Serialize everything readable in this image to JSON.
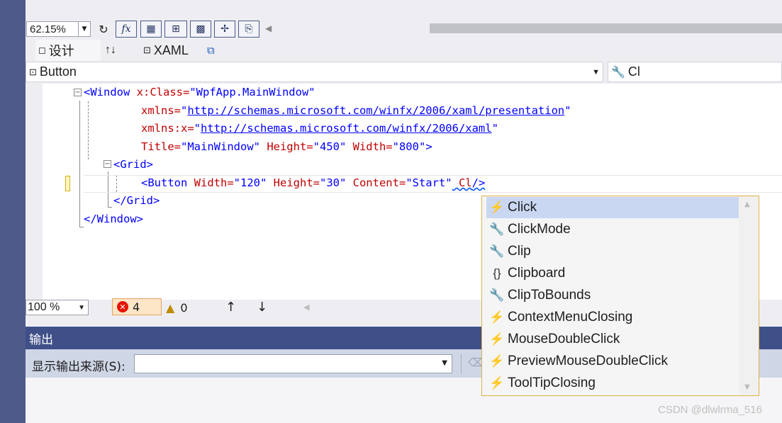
{
  "toolbar": {
    "zoom_value": "62.15%",
    "fx_label": "fx"
  },
  "tabs": {
    "design": "设计",
    "swap": "↑↓",
    "xaml": "XAML"
  },
  "combos": {
    "element": "Button",
    "member": "Cl"
  },
  "code": {
    "l1_tag": "<Window",
    "l1_attr": " x:Class=",
    "l1_val": "\"WpfApp.MainWindow\"",
    "l2_attr": "xmlns=",
    "l2_q1": "\"",
    "l2_url": "http://schemas.microsoft.com/winfx/2006/xaml/presentation",
    "l2_q2": "\"",
    "l3_attr": "xmlns:x=",
    "l3_q1": "\"",
    "l3_url": "http://schemas.microsoft.com/winfx/2006/xaml",
    "l3_q2": "\"",
    "l4_attr1": "Title=",
    "l4_val1": "\"MainWindow\"",
    "l4_attr2": " Height=",
    "l4_val2": "\"450\"",
    "l4_attr3": " Width=",
    "l4_val3": "\"800\"",
    "l4_end": ">",
    "l5": "<Grid>",
    "l6_tag": "<Button",
    "l6_attr1": " Width=",
    "l6_val1": "\"120\"",
    "l6_attr2": " Height=",
    "l6_val2": "\"30\"",
    "l6_attr3": " Content=",
    "l6_val3": "\"Start\"",
    "l6_typed": " Cl",
    "l6_end": "/>",
    "l7": "</Grid>",
    "l8": "</Window>"
  },
  "status": {
    "zoom": "100 %",
    "errors": "4",
    "warnings": "0"
  },
  "output": {
    "title": "输出",
    "source_label": "显示输出来源(S):"
  },
  "completion": {
    "items": [
      {
        "label": "Click",
        "icon": "event-icon",
        "glyph": "⚡"
      },
      {
        "label": "ClickMode",
        "icon": "property-icon",
        "glyph": "🔧"
      },
      {
        "label": "Clip",
        "icon": "property-icon",
        "glyph": "🔧"
      },
      {
        "label": "Clipboard",
        "icon": "namespace-icon",
        "glyph": "{}"
      },
      {
        "label": "ClipToBounds",
        "icon": "property-icon",
        "glyph": "🔧"
      },
      {
        "label": "ContextMenuClosing",
        "icon": "event-icon",
        "glyph": "⚡"
      },
      {
        "label": "MouseDoubleClick",
        "icon": "event-icon",
        "glyph": "⚡"
      },
      {
        "label": "PreviewMouseDoubleClick",
        "icon": "event-icon",
        "glyph": "⚡"
      },
      {
        "label": "ToolTipClosing",
        "icon": "event-icon",
        "glyph": "⚡"
      }
    ],
    "selected_index": 0
  },
  "watermark": "CSDN @dlwlrma_516",
  "colors": {
    "accent": "#3f5088",
    "selection": "#c9d7f3",
    "popup_border": "#e0b245",
    "xaml_tag": "#a31515",
    "xaml_attr": "#c00000",
    "xaml_value": "#0000ff"
  }
}
